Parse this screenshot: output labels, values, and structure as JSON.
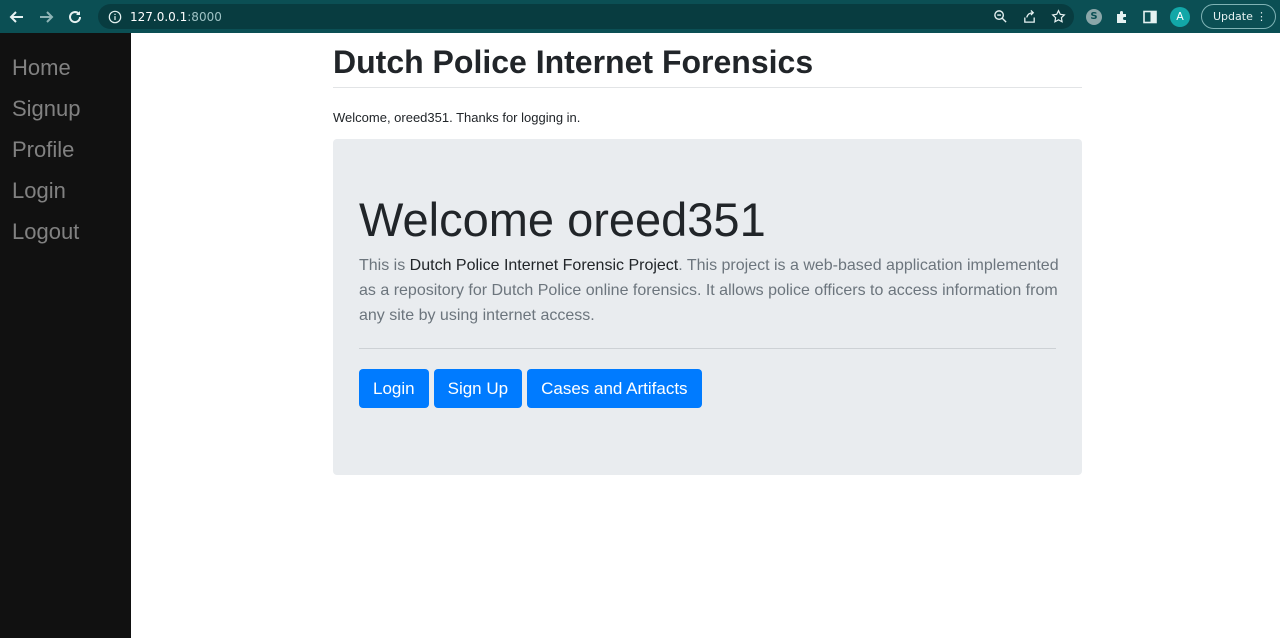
{
  "browser": {
    "url_host": "127.0.0.1",
    "url_port": ":8000",
    "profile_initial": "A",
    "extension_badge": "S",
    "update_label": "Update",
    "menu_glyph": "⋮",
    "icons": [
      "back-arrow-icon",
      "forward-arrow-icon",
      "reload-icon",
      "info-icon",
      "zoom-icon",
      "share-icon",
      "star-icon",
      "puzzle-icon",
      "side-panel-icon"
    ]
  },
  "sidebar": {
    "items": [
      {
        "label": "Home"
      },
      {
        "label": "Signup"
      },
      {
        "label": "Profile"
      },
      {
        "label": "Login"
      },
      {
        "label": "Logout"
      }
    ]
  },
  "main": {
    "title": "Dutch Police Internet Forensics",
    "welcome_note": "Welcome, oreed351. Thanks for logging in.",
    "jumbotron": {
      "heading": "Welcome oreed351",
      "lead_prefix": "This is ",
      "lead_strong": "Dutch Police Internet Forensic Project",
      "lead_suffix": ". This project is a web-based application implemented as a repository for Dutch Police online forensics. It allows police officers to access information from any site by using internet access.",
      "buttons": [
        {
          "label": "Login"
        },
        {
          "label": "Sign Up"
        },
        {
          "label": "Cases and Artifacts"
        }
      ]
    }
  },
  "colors": {
    "chrome_bar": "#0b4f54",
    "sidebar_bg": "#111111",
    "sidebar_link": "#818181",
    "jumbotron_bg": "#e9ecef",
    "primary_button": "#007bff"
  }
}
